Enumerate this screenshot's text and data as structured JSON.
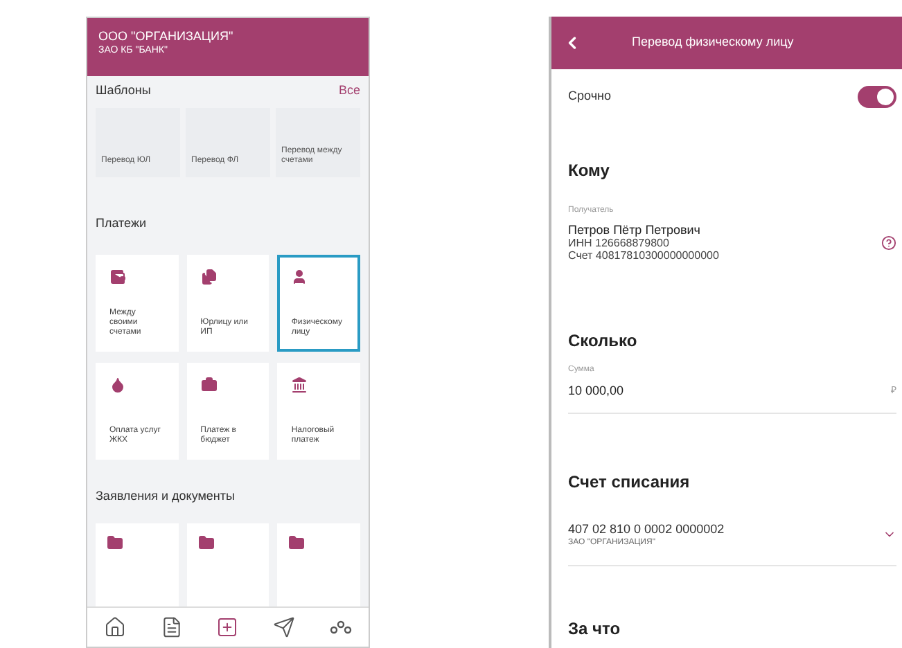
{
  "home": {
    "org_title": "ООО \"ОРГАНИЗАЦИЯ\"",
    "bank_subtitle": "ЗАО КБ \"БАНК\"",
    "templates": {
      "title": "Шаблоны",
      "all_link": "Все",
      "items": [
        {
          "label": "Перевод ЮЛ"
        },
        {
          "label": "Перевод ФЛ"
        },
        {
          "label": "Перевод между счетами"
        }
      ]
    },
    "payments": {
      "title": "Платежи",
      "items": [
        {
          "label": "Между своими счетами",
          "kind": "wallet",
          "selected": false
        },
        {
          "label": "Юрлицу или ИП",
          "kind": "docs",
          "selected": false
        },
        {
          "label": "Физическому лицу",
          "kind": "person",
          "selected": true
        },
        {
          "label": "Оплата услуг ЖКХ",
          "kind": "drop",
          "selected": false
        },
        {
          "label": "Платеж в бюджет",
          "kind": "bag",
          "selected": false
        },
        {
          "label": "Налоговый платеж",
          "kind": "bank",
          "selected": false
        }
      ]
    },
    "documents": {
      "title": "Заявления и документы",
      "items": [
        {
          "kind": "folder"
        },
        {
          "kind": "folder"
        },
        {
          "kind": "folder"
        }
      ]
    },
    "nav": [
      {
        "kind": "home"
      },
      {
        "kind": "doc"
      },
      {
        "kind": "plus"
      },
      {
        "kind": "send"
      },
      {
        "kind": "more"
      }
    ]
  },
  "transfer": {
    "title": "Перевод физическому лицу",
    "urgent": {
      "label": "Срочно",
      "on": true
    },
    "to": {
      "title": "Кому",
      "caption": "Получатель",
      "name": "Петров Пётр Петрович",
      "inn": "ИНН 126668879800",
      "account": "Счет 40817810300000000000"
    },
    "amount": {
      "title": "Сколько",
      "caption": "Сумма",
      "value": "10 000,00",
      "currency": "₽"
    },
    "debit": {
      "title": "Счет списания",
      "account": "407 02 810 0 0002 0000002",
      "owner": "ЗАО \"ОРГАНИЗАЦИЯ\""
    },
    "purpose": {
      "title": "За что"
    }
  }
}
